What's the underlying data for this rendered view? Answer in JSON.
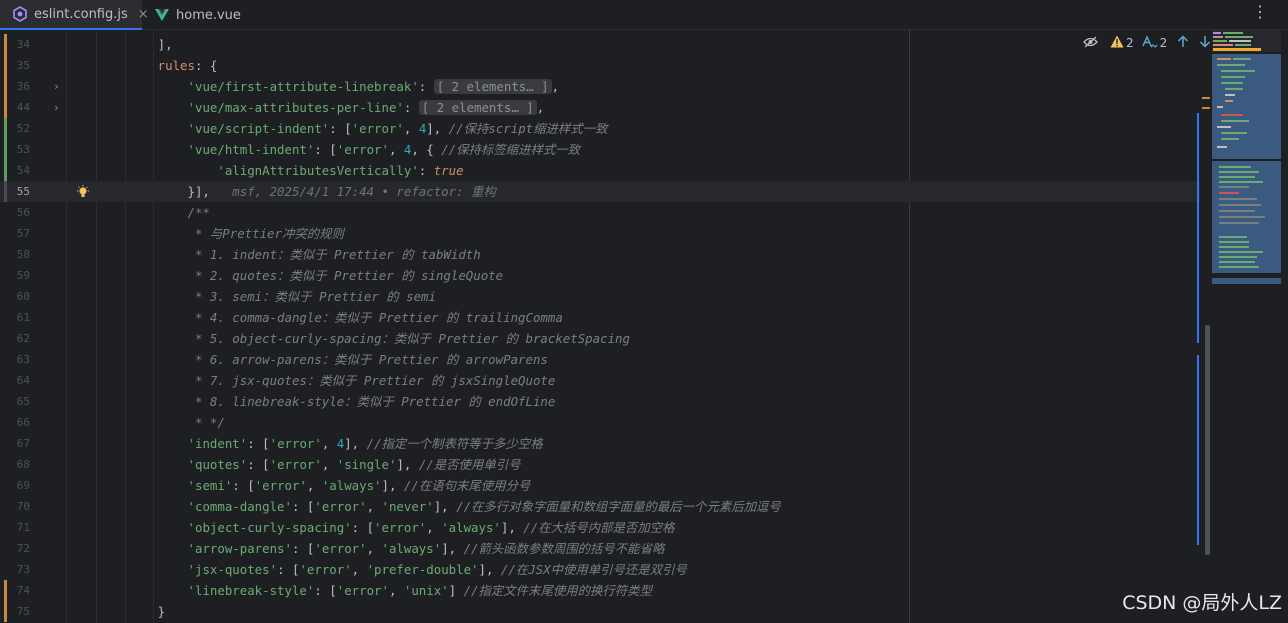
{
  "tabs": [
    {
      "label": "eslint.config.js",
      "active": true,
      "close": "×"
    },
    {
      "label": "home.vue",
      "active": false
    }
  ],
  "menu_glyph": "⋮",
  "inspections": {
    "warnings": "2",
    "typos": "2"
  },
  "blame": "msf, 2025/4/1 17:44 • refactor: 重构",
  "lines": [
    {
      "n": "34",
      "change": "#c9883a",
      "tokens": [
        [
          "p",
          "        ],"
        ]
      ]
    },
    {
      "n": "35",
      "change": "#c9883a",
      "tokens": [
        [
          "k",
          "        rules"
        ],
        [
          "p",
          ": {"
        ]
      ]
    },
    {
      "n": "36",
      "change": "#c9883a",
      "fold": "›",
      "tokens": [
        [
          "p",
          "            "
        ],
        [
          "s",
          "'vue/first-attribute-linebreak'"
        ],
        [
          "p",
          ": "
        ],
        [
          "f",
          "[ 2 elements… ]"
        ],
        [
          "p",
          ","
        ]
      ]
    },
    {
      "n": "44",
      "change": "#c9883a",
      "fold": "›",
      "tokens": [
        [
          "p",
          "            "
        ],
        [
          "s",
          "'vue/max-attributes-per-line'"
        ],
        [
          "p",
          ": "
        ],
        [
          "f",
          "[ 2 elements… ]"
        ],
        [
          "p",
          ","
        ]
      ]
    },
    {
      "n": "52",
      "change": "#5f9e58",
      "tokens": [
        [
          "p",
          "            "
        ],
        [
          "s",
          "'vue/script-indent'"
        ],
        [
          "p",
          ": ["
        ],
        [
          "s",
          "'error'"
        ],
        [
          "p",
          ", "
        ],
        [
          "n",
          "4"
        ],
        [
          "p",
          "], "
        ],
        [
          "c",
          "//保持script缩进样式一致"
        ]
      ]
    },
    {
      "n": "53",
      "change": "#5f9e58",
      "tokens": [
        [
          "p",
          "            "
        ],
        [
          "s",
          "'vue/html-indent'"
        ],
        [
          "p",
          ": ["
        ],
        [
          "s",
          "'error'"
        ],
        [
          "p",
          ", "
        ],
        [
          "n",
          "4"
        ],
        [
          "p",
          ", { "
        ],
        [
          "c",
          "//保持标签缩进样式一致"
        ]
      ]
    },
    {
      "n": "54",
      "change": "#5f9e58",
      "tokens": [
        [
          "p",
          "                "
        ],
        [
          "s",
          "'alignAttributesVertically'"
        ],
        [
          "p",
          ": "
        ],
        [
          "kw",
          "true"
        ]
      ]
    },
    {
      "n": "55",
      "change": "#4a4d52",
      "current": true,
      "bulb": true,
      "tokens": [
        [
          "p",
          "            }],"
        ],
        [
          "b",
          "   msf, 2025/4/1 17:44 • refactor: 重构"
        ]
      ]
    },
    {
      "n": "56",
      "tokens": [
        [
          "c",
          "            /**"
        ]
      ]
    },
    {
      "n": "57",
      "tokens": [
        [
          "c",
          "             * 与Prettier冲突的规则"
        ]
      ]
    },
    {
      "n": "58",
      "tokens": [
        [
          "c",
          "             * 1. indent：类似于 Prettier 的 tabWidth"
        ]
      ]
    },
    {
      "n": "59",
      "tokens": [
        [
          "c",
          "             * 2. quotes：类似于 Prettier 的 singleQuote"
        ]
      ]
    },
    {
      "n": "60",
      "tokens": [
        [
          "c",
          "             * 3. semi：类似于 Prettier 的 semi"
        ]
      ]
    },
    {
      "n": "61",
      "tokens": [
        [
          "c",
          "             * 4. comma-dangle：类似于 Prettier 的 trailingComma"
        ]
      ]
    },
    {
      "n": "62",
      "tokens": [
        [
          "c",
          "             * 5. object-curly-spacing：类似于 Prettier 的 bracketSpacing"
        ]
      ]
    },
    {
      "n": "63",
      "tokens": [
        [
          "c",
          "             * 6. arrow-parens：类似于 Prettier 的 arrowParens"
        ]
      ]
    },
    {
      "n": "64",
      "tokens": [
        [
          "c",
          "             * 7. jsx-quotes：类似于 Prettier 的 jsxSingleQuote"
        ]
      ]
    },
    {
      "n": "65",
      "tokens": [
        [
          "c",
          "             * 8. linebreak-style：类似于 Prettier 的 endOfLine"
        ]
      ]
    },
    {
      "n": "66",
      "tokens": [
        [
          "c",
          "             * */"
        ]
      ]
    },
    {
      "n": "67",
      "tokens": [
        [
          "p",
          "            "
        ],
        [
          "s",
          "'indent'"
        ],
        [
          "p",
          ": ["
        ],
        [
          "s",
          "'error'"
        ],
        [
          "p",
          ", "
        ],
        [
          "n",
          "4"
        ],
        [
          "p",
          "], "
        ],
        [
          "c",
          "//指定一个制表符等于多少空格"
        ]
      ]
    },
    {
      "n": "68",
      "tokens": [
        [
          "p",
          "            "
        ],
        [
          "s",
          "'quotes'"
        ],
        [
          "p",
          ": ["
        ],
        [
          "s",
          "'error'"
        ],
        [
          "p",
          ", "
        ],
        [
          "s",
          "'single'"
        ],
        [
          "p",
          "], "
        ],
        [
          "c",
          "//是否使用单引号"
        ]
      ]
    },
    {
      "n": "69",
      "tokens": [
        [
          "p",
          "            "
        ],
        [
          "s",
          "'semi'"
        ],
        [
          "p",
          ": ["
        ],
        [
          "s",
          "'error'"
        ],
        [
          "p",
          ", "
        ],
        [
          "s",
          "'always'"
        ],
        [
          "p",
          "], "
        ],
        [
          "c",
          "//在语句末尾使用分号"
        ]
      ]
    },
    {
      "n": "70",
      "tokens": [
        [
          "p",
          "            "
        ],
        [
          "s",
          "'comma-dangle'"
        ],
        [
          "p",
          ": ["
        ],
        [
          "s",
          "'error'"
        ],
        [
          "p",
          ", "
        ],
        [
          "s",
          "'never'"
        ],
        [
          "p",
          "], "
        ],
        [
          "c",
          "//在多行对象字面量和数组字面量的最后一个元素后加逗号"
        ]
      ]
    },
    {
      "n": "71",
      "tokens": [
        [
          "p",
          "            "
        ],
        [
          "s",
          "'object-curly-spacing'"
        ],
        [
          "p",
          ": ["
        ],
        [
          "s",
          "'error'"
        ],
        [
          "p",
          ", "
        ],
        [
          "s",
          "'always'"
        ],
        [
          "p",
          "], "
        ],
        [
          "c",
          "//在大括号内部是否加空格"
        ]
      ]
    },
    {
      "n": "72",
      "tokens": [
        [
          "p",
          "            "
        ],
        [
          "s",
          "'arrow-parens'"
        ],
        [
          "p",
          ": ["
        ],
        [
          "s",
          "'error'"
        ],
        [
          "p",
          ", "
        ],
        [
          "s",
          "'always'"
        ],
        [
          "p",
          "], "
        ],
        [
          "c",
          "//箭头函数参数周围的括号不能省略"
        ]
      ]
    },
    {
      "n": "73",
      "tokens": [
        [
          "p",
          "            "
        ],
        [
          "s",
          "'jsx-quotes'"
        ],
        [
          "p",
          ": ["
        ],
        [
          "s",
          "'error'"
        ],
        [
          "p",
          ", "
        ],
        [
          "s",
          "'prefer-double'"
        ],
        [
          "p",
          "], "
        ],
        [
          "c",
          "//在JSX中使用单引号还是双引号"
        ]
      ]
    },
    {
      "n": "74",
      "change": "#c9883a",
      "tokens": [
        [
          "p",
          "            "
        ],
        [
          "s",
          "'linebreak-style'"
        ],
        [
          "p",
          ": ["
        ],
        [
          "s",
          "'error'"
        ],
        [
          "p",
          ", "
        ],
        [
          "s",
          "'unix'"
        ],
        [
          "p",
          "] "
        ],
        [
          "c",
          "//指定文件末尾使用的换行符类型"
        ]
      ]
    },
    {
      "n": "75",
      "change": "#c9883a",
      "tokens": [
        [
          "p",
          "        }"
        ]
      ]
    }
  ],
  "watermark": "CSDN @局外人LZ",
  "colors": {
    "accent": "#3574f0",
    "warning": "#f2c55c",
    "string": "#6aab73",
    "number": "#2aacb8",
    "comment": "#7a7e85",
    "keyword": "#cf8e6d"
  }
}
